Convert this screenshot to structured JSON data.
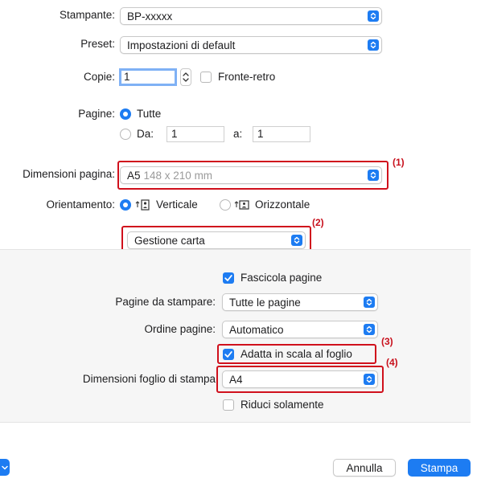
{
  "printer": {
    "label": "Stampante:",
    "value": "BP-xxxxx"
  },
  "preset": {
    "label": "Preset:",
    "value": "Impostazioni di default"
  },
  "copies": {
    "label": "Copie:",
    "value": "1",
    "duplex_label": "Fronte-retro",
    "duplex_checked": false
  },
  "pages": {
    "label": "Pagine:",
    "all_label": "Tutte",
    "range_label": "Da:",
    "from": "1",
    "to_label": "a:",
    "to": "1"
  },
  "paper_size": {
    "label": "Dimensioni pagina:",
    "value": "A5",
    "detail": "148 x 210 mm"
  },
  "orientation": {
    "label": "Orientamento:",
    "portrait": "Verticale",
    "landscape": "Orizzontale",
    "selected": "portrait"
  },
  "section": {
    "value": "Gestione carta"
  },
  "paper_handling": {
    "collate_label": "Fascicola pagine",
    "collate_checked": true,
    "pages_to_print_label": "Pagine da stampare:",
    "pages_to_print": "Tutte le pagine",
    "page_order_label": "Ordine pagine:",
    "page_order": "Automatico",
    "scale_label": "Adatta in scala al foglio",
    "scale_checked": true,
    "dest_size_label": "Dimensioni foglio di stampa",
    "dest_size": "A4",
    "scale_down_label": "Riduci solamente",
    "scale_down_checked": false
  },
  "annotations": [
    "(1)",
    "(2)",
    "(3)",
    "(4)"
  ],
  "buttons": {
    "cancel": "Annulla",
    "print": "Stampa"
  },
  "colors": {
    "accent": "#1d7cf2",
    "callout": "#d0101c",
    "panel": "#f6f6f6"
  }
}
